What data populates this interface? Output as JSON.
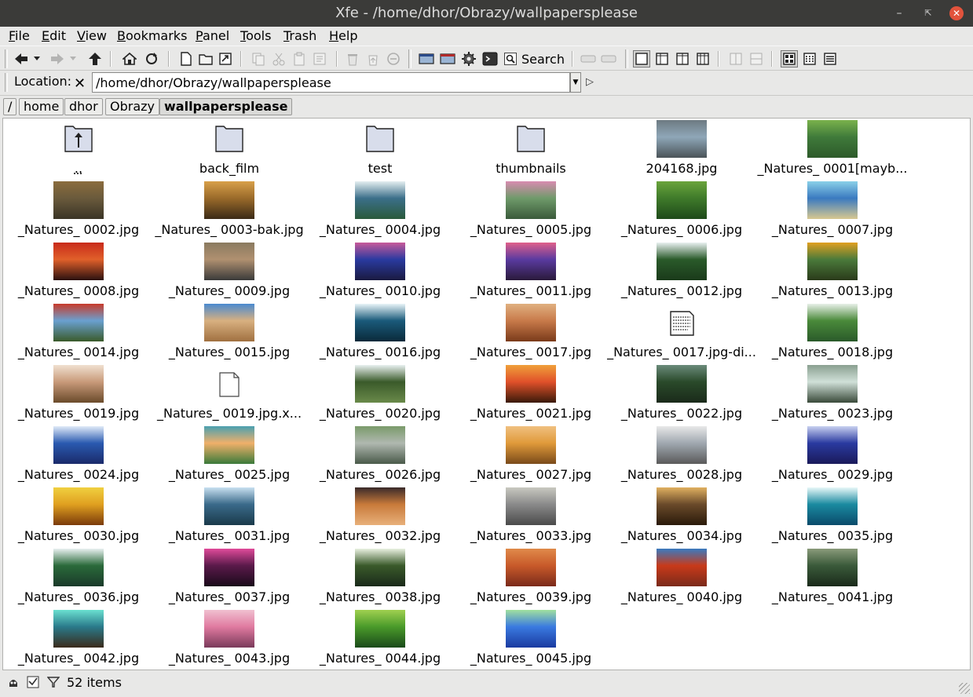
{
  "window": {
    "title": "Xfe - /home/dhor/Obrazy/wallpapersplease"
  },
  "menu": [
    {
      "label": "File",
      "key": "F",
      "rest": "ile"
    },
    {
      "label": "Edit",
      "key": "E",
      "rest": "dit"
    },
    {
      "label": "View",
      "key": "V",
      "rest": "iew"
    },
    {
      "label": "Bookmarks",
      "key": "B",
      "rest": "ookmarks"
    },
    {
      "label": "Panel",
      "key": "P",
      "rest": "anel"
    },
    {
      "label": "Tools",
      "key": "T",
      "rest": "ools"
    },
    {
      "label": "Trash",
      "key": "T",
      "rest": "rash"
    },
    {
      "label": "Help",
      "key": "H",
      "rest": "elp"
    }
  ],
  "toolbar": {
    "search_label": "Search"
  },
  "location": {
    "label": "Location:",
    "path": "/home/dhor/Obrazy/wallpapersplease"
  },
  "breadcrumbs": [
    "/",
    "home",
    "dhor",
    "Obrazy",
    "wallpapersplease"
  ],
  "files": [
    {
      "name": "..",
      "kind": "up"
    },
    {
      "name": "back_film",
      "kind": "folder"
    },
    {
      "name": "test",
      "kind": "folder"
    },
    {
      "name": "thumbnails",
      "kind": "folder"
    },
    {
      "name": "204168.jpg",
      "kind": "image",
      "colors": [
        "#8fa7b8",
        "#6d7a82",
        "#4a5358"
      ]
    },
    {
      "name": "_Natures_ 0001[mayb...",
      "kind": "image",
      "colors": [
        "#3f7a3a",
        "#7ab24c",
        "#2d5a2a"
      ]
    },
    {
      "name": "_Natures_ 0002.jpg",
      "kind": "image",
      "colors": [
        "#6a5a3c",
        "#8b6c3d",
        "#3a3426"
      ]
    },
    {
      "name": "_Natures_ 0003-bak.jpg",
      "kind": "image",
      "colors": [
        "#9a6a2a",
        "#d8a04a",
        "#3a2a16"
      ]
    },
    {
      "name": "_Natures_ 0004.jpg",
      "kind": "image",
      "colors": [
        "#3b6f8a",
        "#e4eef0",
        "#2a5a3a"
      ]
    },
    {
      "name": "_Natures_ 0005.jpg",
      "kind": "image",
      "colors": [
        "#6f9a6a",
        "#d88cb0",
        "#3a5a3a"
      ]
    },
    {
      "name": "_Natures_ 0006.jpg",
      "kind": "image",
      "colors": [
        "#3f7a2a",
        "#6aa43c",
        "#1e4a1a"
      ]
    },
    {
      "name": "_Natures_ 0007.jpg",
      "kind": "image",
      "colors": [
        "#3a7ac0",
        "#8ad0e8",
        "#d8c890"
      ]
    },
    {
      "name": "_Natures_ 0008.jpg",
      "kind": "image",
      "colors": [
        "#e0602a",
        "#c82a1a",
        "#2a1010"
      ]
    },
    {
      "name": "_Natures_ 0009.jpg",
      "kind": "image",
      "colors": [
        "#b09070",
        "#8a7a60",
        "#3a3a3a"
      ]
    },
    {
      "name": "_Natures_ 0010.jpg",
      "kind": "image",
      "colors": [
        "#2a3aa0",
        "#c85a9a",
        "#1a1a40"
      ]
    },
    {
      "name": "_Natures_ 0011.jpg",
      "kind": "image",
      "colors": [
        "#5a3aa0",
        "#e0608a",
        "#2a1a3a"
      ]
    },
    {
      "name": "_Natures_ 0012.jpg",
      "kind": "image",
      "colors": [
        "#2a5a2a",
        "#e8f0f0",
        "#1a3a1a"
      ]
    },
    {
      "name": "_Natures_ 0013.jpg",
      "kind": "image",
      "colors": [
        "#4a7a3a",
        "#e0a020",
        "#2a3a1a"
      ]
    },
    {
      "name": "_Natures_ 0014.jpg",
      "kind": "image",
      "colors": [
        "#6aa0d0",
        "#c83a2a",
        "#3a5a2a"
      ]
    },
    {
      "name": "_Natures_ 0015.jpg",
      "kind": "image",
      "colors": [
        "#d8b080",
        "#4a8ad0",
        "#a07040"
      ]
    },
    {
      "name": "_Natures_ 0016.jpg",
      "kind": "image",
      "colors": [
        "#1a5a7a",
        "#e8f4f8",
        "#0a2a3a"
      ]
    },
    {
      "name": "_Natures_ 0017.jpg",
      "kind": "image",
      "colors": [
        "#c87a4a",
        "#e0b080",
        "#7a3a1a"
      ]
    },
    {
      "name": "_Natures_ 0017.jpg-di...",
      "kind": "text"
    },
    {
      "name": "_Natures_ 0018.jpg",
      "kind": "image",
      "colors": [
        "#4a8a3a",
        "#e8f0e8",
        "#2a5a2a"
      ]
    },
    {
      "name": "_Natures_ 0019.jpg",
      "kind": "image",
      "colors": [
        "#c89a7a",
        "#f0e0d0",
        "#6a4a2a"
      ]
    },
    {
      "name": "_Natures_ 0019.jpg.x...",
      "kind": "blank"
    },
    {
      "name": "_Natures_ 0020.jpg",
      "kind": "image",
      "colors": [
        "#3a5a2a",
        "#e8f0f0",
        "#6a8a4a"
      ]
    },
    {
      "name": "_Natures_ 0021.jpg",
      "kind": "image",
      "colors": [
        "#e0502a",
        "#f0a03a",
        "#3a1a0a"
      ]
    },
    {
      "name": "_Natures_ 0022.jpg",
      "kind": "image",
      "colors": [
        "#2a4a2a",
        "#6a8a7a",
        "#1a2a1a"
      ]
    },
    {
      "name": "_Natures_ 0023.jpg",
      "kind": "image",
      "colors": [
        "#d0e0d8",
        "#8aa090",
        "#3a4a3a"
      ]
    },
    {
      "name": "_Natures_ 0024.jpg",
      "kind": "image",
      "colors": [
        "#2a5ab0",
        "#e0eaf8",
        "#1a2a6a"
      ]
    },
    {
      "name": "_Natures_ 0025.jpg",
      "kind": "image",
      "colors": [
        "#f0b06a",
        "#4aa0b0",
        "#3a7a3a"
      ]
    },
    {
      "name": "_Natures_ 0026.jpg",
      "kind": "image",
      "colors": [
        "#b0b8b0",
        "#7a9a6a",
        "#4a5a4a"
      ]
    },
    {
      "name": "_Natures_ 0027.jpg",
      "kind": "image",
      "colors": [
        "#e09a3a",
        "#f0c080",
        "#7a4a1a"
      ]
    },
    {
      "name": "_Natures_ 0028.jpg",
      "kind": "image",
      "colors": [
        "#a0a8b0",
        "#e8e8e8",
        "#5a5a5a"
      ]
    },
    {
      "name": "_Natures_ 0029.jpg",
      "kind": "image",
      "colors": [
        "#2a3aa0",
        "#c8d0f0",
        "#1a1a5a"
      ]
    },
    {
      "name": "_Natures_ 0030.jpg",
      "kind": "image",
      "colors": [
        "#e0a020",
        "#f0d040",
        "#7a3a0a"
      ]
    },
    {
      "name": "_Natures_ 0031.jpg",
      "kind": "image",
      "colors": [
        "#3a6a8a",
        "#c8e0f0",
        "#1a3a4a"
      ]
    },
    {
      "name": "_Natures_ 0032.jpg",
      "kind": "image",
      "colors": [
        "#c87a3a",
        "#3a2a2a",
        "#e8b07a"
      ]
    },
    {
      "name": "_Natures_ 0033.jpg",
      "kind": "image",
      "colors": [
        "#8a8a8a",
        "#c8c8c0",
        "#4a4a4a"
      ]
    },
    {
      "name": "_Natures_ 0034.jpg",
      "kind": "image",
      "colors": [
        "#6a4a2a",
        "#e0b060",
        "#2a1a0a"
      ]
    },
    {
      "name": "_Natures_ 0035.jpg",
      "kind": "image",
      "colors": [
        "#1a8aa0",
        "#e8f8f8",
        "#0a4a6a"
      ]
    },
    {
      "name": "_Natures_ 0036.jpg",
      "kind": "image",
      "colors": [
        "#2a6a3a",
        "#e8f0f0",
        "#1a3a2a"
      ]
    },
    {
      "name": "_Natures_ 0037.jpg",
      "kind": "image",
      "colors": [
        "#5a1a4a",
        "#e04a9a",
        "#1a0a1a"
      ]
    },
    {
      "name": "_Natures_ 0038.jpg",
      "kind": "image",
      "colors": [
        "#3a5a2a",
        "#e8f0e0",
        "#1a2a1a"
      ]
    },
    {
      "name": "_Natures_ 0039.jpg",
      "kind": "image",
      "colors": [
        "#c85a2a",
        "#e08a4a",
        "#7a2a1a"
      ]
    },
    {
      "name": "_Natures_ 0040.jpg",
      "kind": "image",
      "colors": [
        "#c83a1a",
        "#3a7ac0",
        "#7a2a1a"
      ]
    },
    {
      "name": "_Natures_ 0041.jpg",
      "kind": "image",
      "colors": [
        "#3a5a3a",
        "#8a9a7a",
        "#1a2a1a"
      ]
    },
    {
      "name": "_Natures_ 0042.jpg",
      "kind": "image",
      "colors": [
        "#2a7a8a",
        "#6ae0d0",
        "#3a2a1a"
      ]
    },
    {
      "name": "_Natures_ 0043.jpg",
      "kind": "image",
      "colors": [
        "#e07aa0",
        "#f0c0d0",
        "#7a3a5a"
      ]
    },
    {
      "name": "_Natures_ 0044.jpg",
      "kind": "image",
      "colors": [
        "#4a9a2a",
        "#a0d050",
        "#1a4a1a"
      ]
    },
    {
      "name": "_Natures_ 0045.jpg",
      "kind": "image",
      "colors": [
        "#3a7ae0",
        "#a0e0a0",
        "#1a3aa0"
      ]
    }
  ],
  "status": {
    "count": "52 items"
  },
  "colors": {
    "titlebar": "#3b3b39",
    "close": "#e2533c",
    "background": "#e8e8e7",
    "selection_folder": "#d8ddeb"
  }
}
